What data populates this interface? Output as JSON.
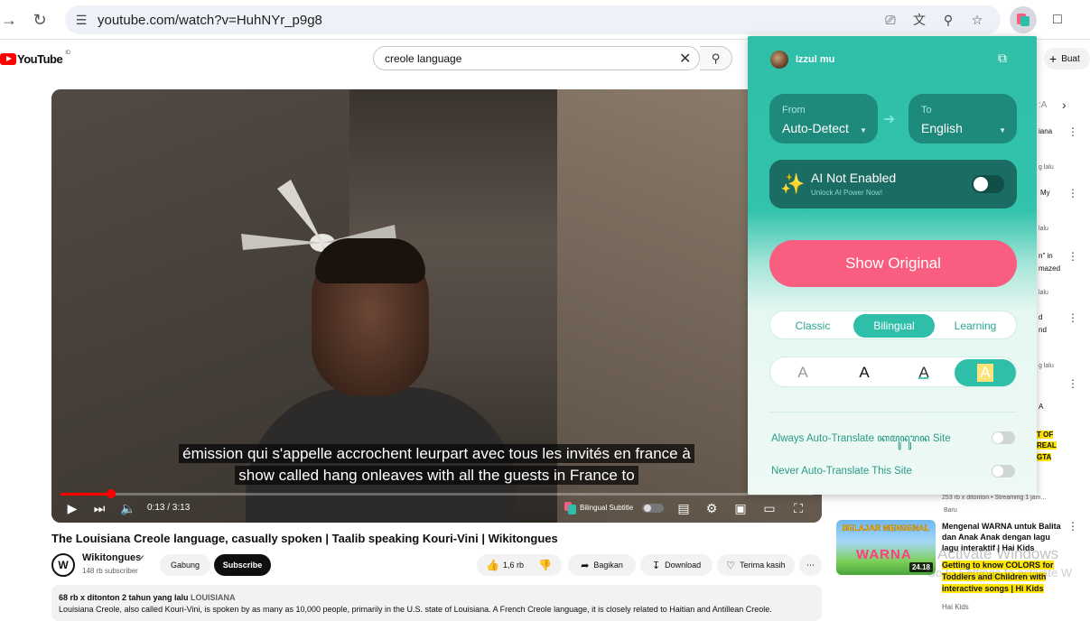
{
  "browser": {
    "url": "youtube.com/watch?v=HuhNYr_p9g8"
  },
  "youtube": {
    "logo_text": "YouTube",
    "region": "ID",
    "search_value": "creole language",
    "create_label": "Buat"
  },
  "video": {
    "subtitle_line1": "émission qui s'appelle accrochent leurpart avec tous les invités en france à",
    "subtitle_line2": "show called hang onleaves with all the guests in France to",
    "time": "0:13 / 3:13",
    "progress_fraction": 0.067,
    "bilingual_label": "Bilingual Subtitle",
    "title": "The Louisiana Creole language, casually spoken | Taalib speaking Kouri-Vini | Wikitongues",
    "channel_name": "Wikitongues",
    "channel_subs": "148 rb subscriber",
    "join_label": "Gabung",
    "subscribe_label": "Subscribe",
    "likes": "1,6 rb",
    "share_label": "Bagikan",
    "download_label": "Download",
    "thanks_label": "Terima kasih",
    "desc_meta": "68 rb x ditonton  2 tahun yang lalu",
    "desc_tag": "LOUISIANA",
    "desc_text": "Louisiana Creole, also called Kouri-Vini, is spoken by as many as 10,000 people, primarily in the U.S. state of Louisiana. A French Creole language, it is closely related to Haitian and Antillean Creole."
  },
  "sidebar": {
    "fragments": [
      "iana",
      "g lalu",
      "My",
      "lalu",
      "n\" in",
      "mazed",
      "lalu",
      "d",
      "nd",
      "g lalu",
      "A",
      "T OF",
      "REAL",
      "GTA"
    ],
    "prev_meta": "253 rb x ditonton • Streaming 1 jam...",
    "prev_new": "Baru",
    "video_title": "Mengenal WARNA untuk Balita dan Anak Anak dengan lagu lagu interaktif | Hai Kids",
    "thumb_title": "BELAJAR MENGENAL",
    "thumb_word": "WARNA",
    "thumb_duration": "24.18",
    "snippet": "Getting to know COLORS for Toddlers and Children with interactive songs | Hi Kids",
    "channel": "Hai Kids",
    "watermark_1": "Activate Windows",
    "watermark_2": "Go to Settings to activate W"
  },
  "popup": {
    "user_name": "Izzul mu",
    "from_label": "From",
    "from_value": "Auto-Detect",
    "to_label": "To",
    "to_value": "English",
    "ai_title": "AI Not Enabled",
    "ai_sub": "Unlock AI Power Now!",
    "ai_enabled": false,
    "show_original_label": "Show Original",
    "modes": [
      "Classic",
      "Bilingual",
      "Learning"
    ],
    "active_mode": "Bilingual",
    "style_glyph": "A",
    "always_label": "Always Auto-Translate ꦏꦩꦸꦤꦸꦫꦤ Site",
    "never_label": "Never Auto-Translate This Site",
    "always_enabled": false,
    "never_enabled": false
  },
  "colors": {
    "accent": "#2fbfa9",
    "show_original": "#f95d80",
    "youtube_red": "#ff0000"
  }
}
